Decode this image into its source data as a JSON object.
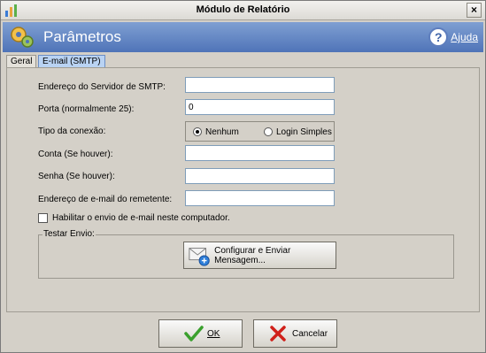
{
  "window": {
    "title": "Módulo de Relatório",
    "close_icon": "close-icon"
  },
  "header": {
    "title": "Parâmetros",
    "help_label": "Ajuda"
  },
  "tabs": [
    {
      "label": "Geral",
      "active": false
    },
    {
      "label": "E-mail (SMTP)",
      "active": true
    }
  ],
  "form": {
    "smtp_server_label": "Endereço do Servidor de SMTP:",
    "smtp_server_value": "",
    "port_label": "Porta (normalmente 25):",
    "port_value": "0",
    "connection_label": "Tipo da conexão:",
    "connection_options": [
      "Nenhum",
      "Login Simples"
    ],
    "connection_selected": "Nenhum",
    "account_label": "Conta (Se houver):",
    "account_value": "",
    "password_label": "Senha (Se houver):",
    "password_value": "",
    "sender_label": "Endereço de e-mail do remetente:",
    "sender_value": "",
    "enable_label": "Habilitar o envio de e-mail neste computador.",
    "enable_checked": false
  },
  "test_group": {
    "title": "Testar Envio:",
    "configure_button": "Configurar e Enviar Mensagem..."
  },
  "footer": {
    "ok_label": "OK",
    "cancel_label": "Cancelar"
  },
  "colors": {
    "header": "#4f74b8",
    "active_tab": "#b9d3f3",
    "ok_check": "#3aa02d",
    "cancel_x": "#d0201a"
  }
}
